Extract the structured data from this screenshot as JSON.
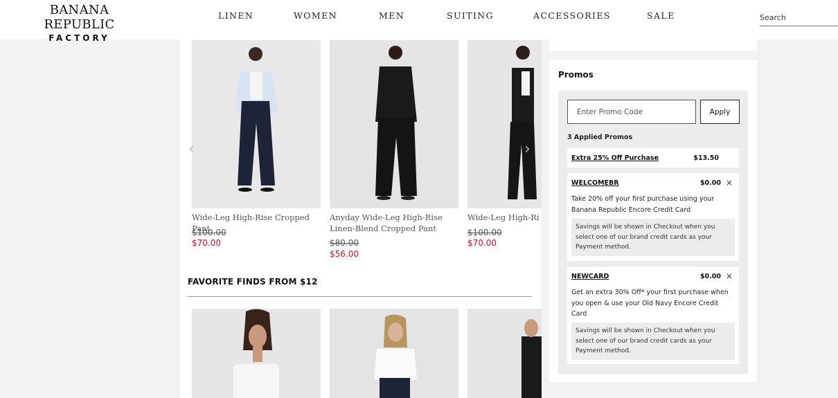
{
  "brand": {
    "line1": "BANANA REPUBLIC",
    "line2": "FACTORY"
  },
  "nav": [
    "LINEN",
    "WOMEN",
    "MEN",
    "SUITING",
    "ACCESSORIES",
    "SALE"
  ],
  "search": {
    "placeholder": "Search"
  },
  "products": [
    {
      "title": "Wide-Leg High-Rise Cropped Pant",
      "price_old": "$100.00",
      "price_new": "$70.00"
    },
    {
      "title": "Anyday Wide-Leg High-Rise Linen-Blend Cropped Pant",
      "price_old": "$80.00",
      "price_new": "$56.00"
    },
    {
      "title": "Wide-Leg High-Ri",
      "price_old": "$100.00",
      "price_new": "$70.00"
    }
  ],
  "section": {
    "title": "FAVORITE FINDS FROM $12"
  },
  "promos": {
    "title": "Promos",
    "input_placeholder": "Enter Promo Code",
    "apply_label": "Apply",
    "applied_count": "3 Applied Promos",
    "items": [
      {
        "name": "Extra 25% Off Purchase",
        "amount": "$13.50"
      },
      {
        "name": "WELCOMEBR",
        "amount": "$0.00",
        "remove": "×",
        "desc": "Take 20% off your first purchase using your Banana Republic Encore Credit Card",
        "note": "Savings will be shown in Checkout when you select one of our brand credit cards as your Payment method."
      },
      {
        "name": "NEWCARD",
        "amount": "$0.00",
        "remove": "×",
        "desc": "Get an extra 30% Off* your first purchase when you open & use your Old Navy Encore Credit Card",
        "note": "Savings will be shown in Checkout when you select one of our brand credit cards as your Payment method."
      }
    ]
  },
  "icons": {
    "carousel_prev": "chevron-left-icon",
    "carousel_next": "chevron-right-icon",
    "remove": "close-icon"
  },
  "colors": {
    "sale_price": "#c8102e",
    "page_bg": "#f2f2f2"
  }
}
